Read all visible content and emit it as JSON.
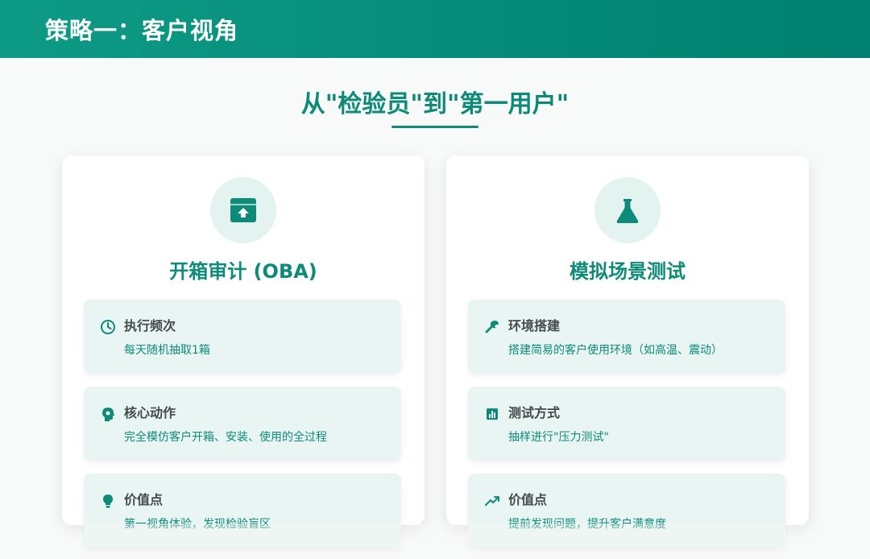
{
  "header": {
    "title": "策略一：客户视角"
  },
  "subtitle": "从\"检验员\"到\"第一用户\"",
  "colors": {
    "accent": "#0d8a78",
    "header_start": "#0d9b86",
    "header_end": "#00806f",
    "item_bg": "#e9f5f2"
  },
  "cards": [
    {
      "title": "开箱审计 (OBA)",
      "icon": "box-upload-icon",
      "items": [
        {
          "icon": "clock-icon",
          "label": "执行频次",
          "desc": "每天随机抽取1箱"
        },
        {
          "icon": "brain-head-icon",
          "label": "核心动作",
          "desc": "完全模仿客户开箱、安装、使用的全过程"
        },
        {
          "icon": "lightbulb-icon",
          "label": "价值点",
          "desc": "第一视角体验，发现检验盲区"
        }
      ]
    },
    {
      "title": "模拟场景测试",
      "icon": "flask-icon",
      "items": [
        {
          "icon": "wrench-icon",
          "label": "环境搭建",
          "desc": "搭建简易的客户使用环境（如高温、震动）"
        },
        {
          "icon": "bar-chart-icon",
          "label": "测试方式",
          "desc": "抽样进行\"压力测试\""
        },
        {
          "icon": "trend-up-icon",
          "label": "价值点",
          "desc": "提前发现问题，提升客户满意度"
        }
      ]
    }
  ]
}
